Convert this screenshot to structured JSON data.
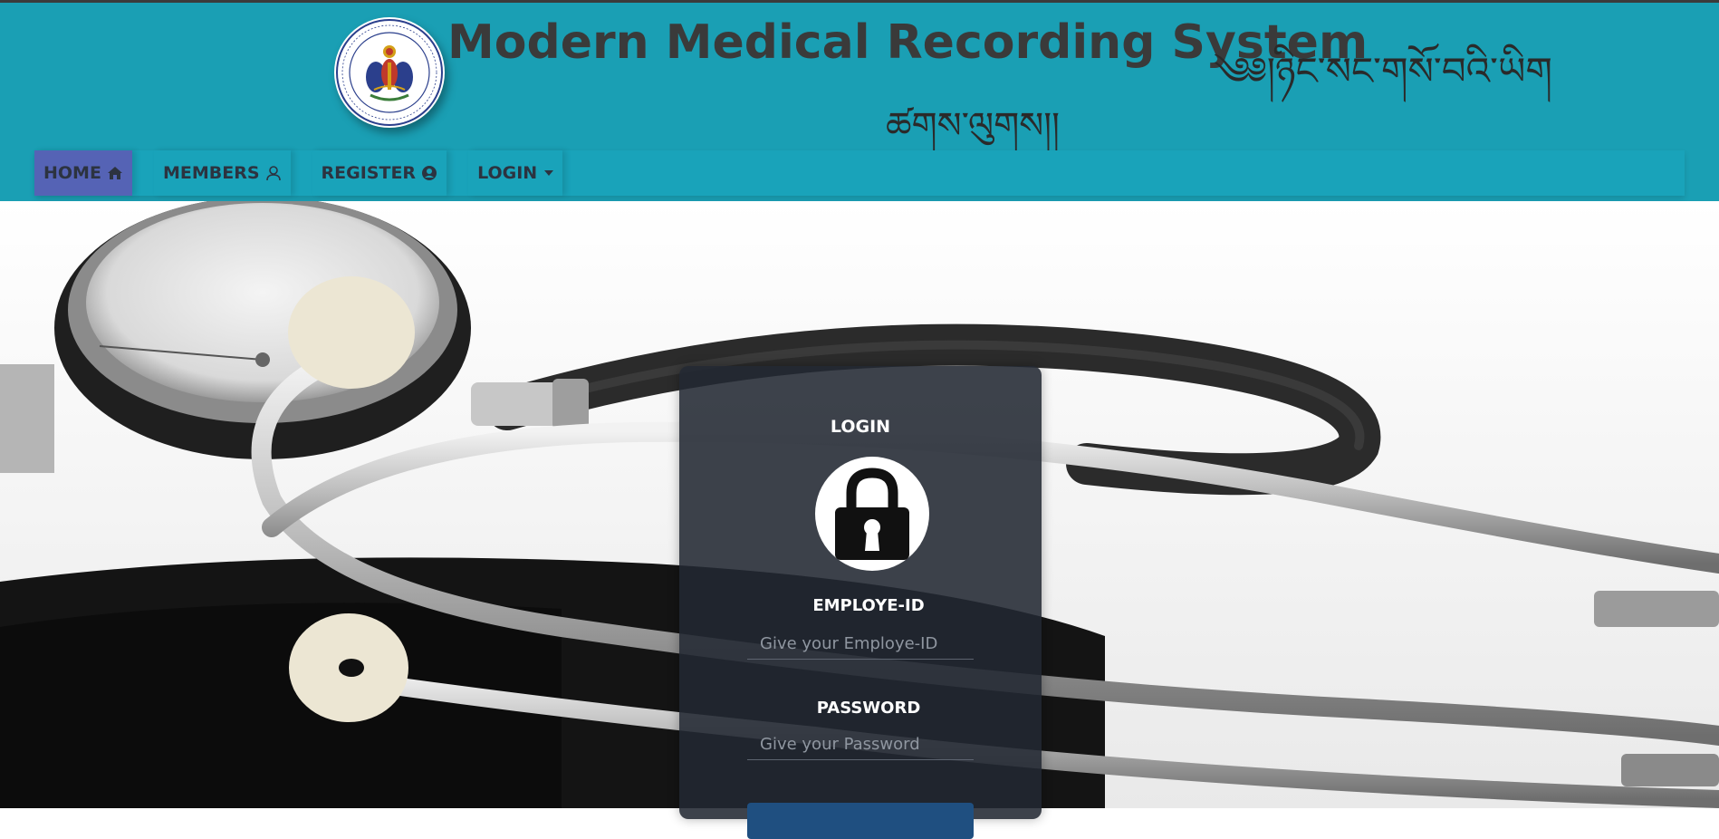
{
  "header": {
    "title": "Modern Medical Recording System",
    "tibetan_line1": "༄༅།ཉིང་སང་གསོ་བའི་ཡིག",
    "tibetan_line2": "ཚགས་ལུགས།།"
  },
  "nav": {
    "items": [
      {
        "label": "HOME",
        "icon": "home-icon",
        "active": true
      },
      {
        "label": "MEMBERS",
        "icon": "user-outline-icon"
      },
      {
        "label": "REGISTER",
        "icon": "user-circle-icon"
      },
      {
        "label": "LOGIN",
        "icon": "caret-down-icon"
      }
    ]
  },
  "login": {
    "title": "LOGIN",
    "lock_icon": "lock-icon",
    "employee_label": "EMPLOYE-ID",
    "employee_placeholder": "Give your Employe-ID",
    "password_label": "PASSWORD",
    "password_placeholder": "Give your Password"
  },
  "colors": {
    "header_bg": "#1a9fb4",
    "nav_active": "#5563b5",
    "card_bg": "#222832"
  }
}
